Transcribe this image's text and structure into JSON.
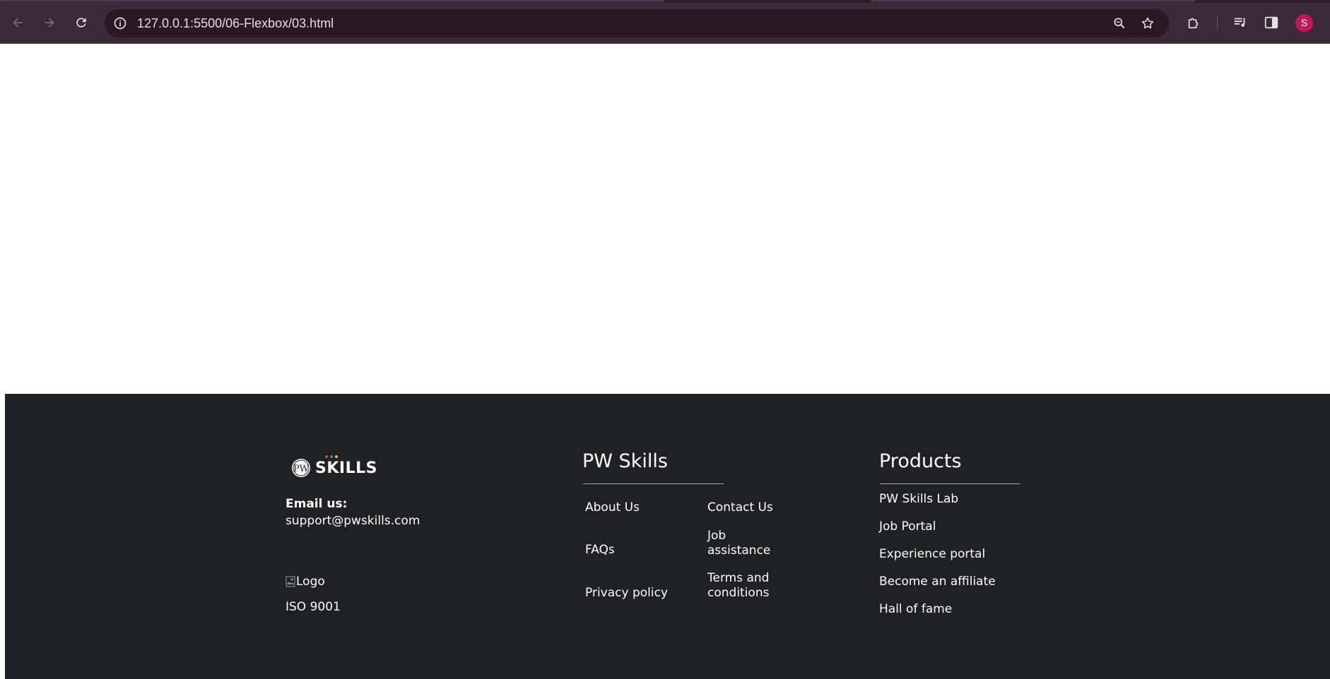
{
  "browser": {
    "url": "127.0.0.1:5500/06-Flexbox/03.html",
    "avatar_letter": "S"
  },
  "footer": {
    "brand": {
      "wordmark": "SKILLS",
      "seal_letters": "PW"
    },
    "email_label": "Email us:",
    "email_value": "support@pwskills.com",
    "logo_alt": "Logo",
    "iso": "ISO 9001",
    "pw_skills": {
      "title": "PW Skills",
      "links_left": [
        "About Us",
        "FAQs",
        "Privacy policy"
      ],
      "links_right": [
        "Contact Us",
        "Job assistance",
        "Terms and conditions"
      ]
    },
    "products": {
      "title": "Products",
      "links": [
        "PW Skills Lab",
        "Job Portal",
        "Experience portal",
        "Become an affiliate",
        "Hall of fame"
      ]
    }
  },
  "colors": {
    "chrome": "#3c2a38",
    "footer_bg": "#1e2226",
    "accent_rule": "#c9a063",
    "avatar": "#c2185b"
  }
}
